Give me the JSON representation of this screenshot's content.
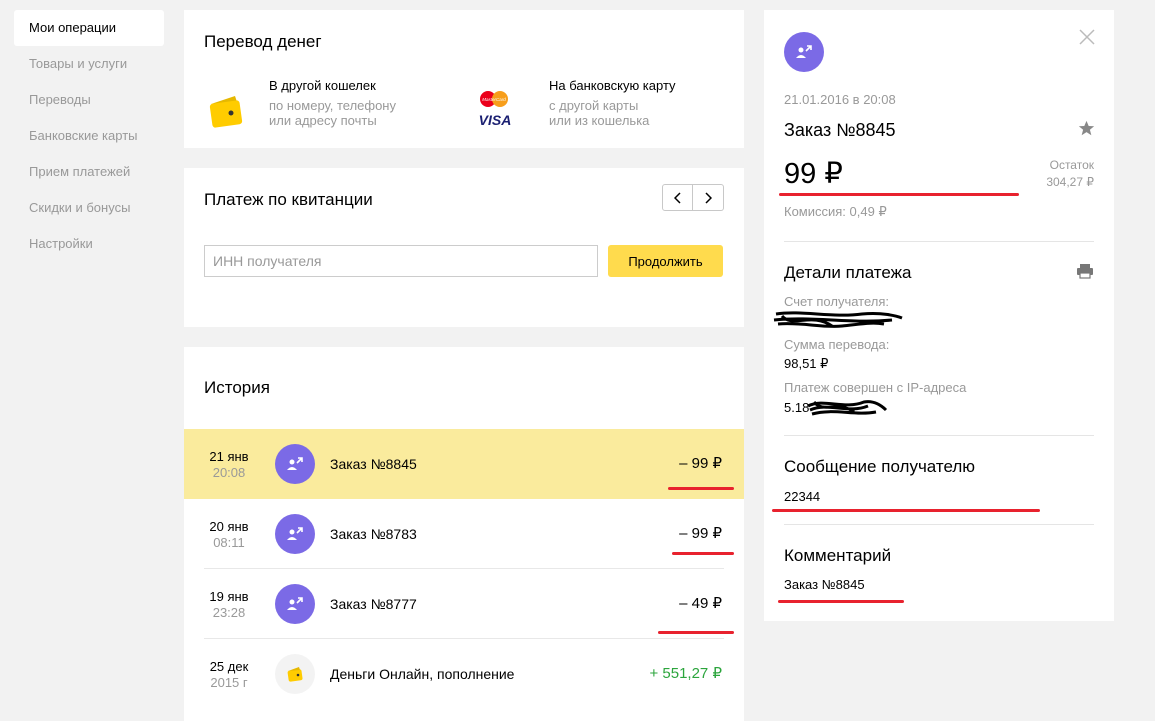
{
  "sidebar": {
    "items": [
      {
        "label": "Мои операции"
      },
      {
        "label": "Товары и услуги"
      },
      {
        "label": "Переводы"
      },
      {
        "label": "Банковские карты"
      },
      {
        "label": "Прием платежей"
      },
      {
        "label": "Скидки и бонусы"
      },
      {
        "label": "Настройки"
      }
    ]
  },
  "transfer": {
    "title": "Перевод денег",
    "wallet": {
      "title": "В другой кошелек",
      "sub1": "по номеру, телефону",
      "sub2": "или адресу почты"
    },
    "card": {
      "title": "На банковскую карту",
      "sub1": "с другой карты",
      "sub2": "или из кошелька",
      "mc_text": "MasterCard",
      "visa_text": "VISA"
    }
  },
  "receipt": {
    "title": "Платеж по квитанции",
    "inn_placeholder": "ИНН получателя",
    "continue_label": "Продолжить"
  },
  "history": {
    "title": "История",
    "rows": [
      {
        "date": "21 янв",
        "time": "20:08",
        "name": "Заказ №8845",
        "amount": "– 99 ₽"
      },
      {
        "date": "20 янв",
        "time": "08:11",
        "name": "Заказ №8783",
        "amount": "– 99 ₽"
      },
      {
        "date": "19 янв",
        "time": "23:28",
        "name": "Заказ №8777",
        "amount": "– 49 ₽"
      },
      {
        "date": "25 дек",
        "time": "2015 г",
        "name": "Деньги Онлайн, пополнение",
        "amount": "+ 551,27 ₽"
      }
    ]
  },
  "detail": {
    "datetime": "21.01.2016 в 20:08",
    "order": "Заказ №8845",
    "amount": "99 ₽",
    "rest_label": "Остаток",
    "rest_value": "304,27 ₽",
    "fee": "Комиссия: 0,49 ₽",
    "payment_details_title": "Детали платежа",
    "account_label": "Счет получателя:",
    "sum_label": "Сумма перевода:",
    "sum_value": "98,51 ₽",
    "ip_label": "Платеж совершен с IP-адреса",
    "ip_value": "5.18",
    "message_title": "Сообщение получателю",
    "message_value": "22344",
    "comment_title": "Комментарий",
    "comment_value": "Заказ №8845"
  },
  "colors": {
    "accent_yellow": "#ffdb4d",
    "highlight_row": "#faeb9d",
    "purple_icon": "#7b6ae6",
    "income_green": "#2ca53d",
    "annotation_red": "#e8222e"
  }
}
